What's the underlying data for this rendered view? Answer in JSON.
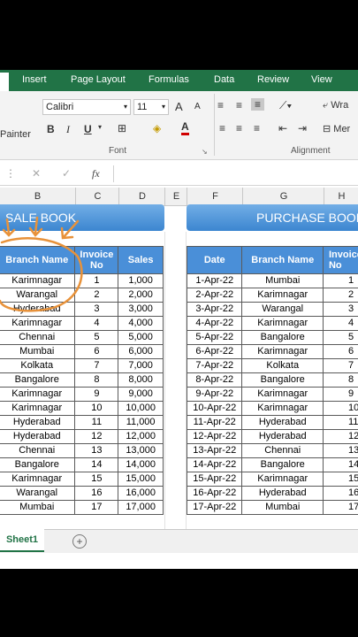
{
  "ribbon_tabs": [
    "Insert",
    "Page Layout",
    "Formulas",
    "Data",
    "Review",
    "View"
  ],
  "ribbon": {
    "font_name": "Calibri",
    "font_size": "11",
    "painter_label": "Painter",
    "font_group_label": "Font",
    "alignment_group_label": "Alignment",
    "wrap_label": "Wra",
    "merge_label": "Mer",
    "bold": "B",
    "italic": "I",
    "underline": "U",
    "grow_font": "A",
    "shrink_font": "A",
    "font_color": "A"
  },
  "formula_bar": {
    "cancel": "✕",
    "enter": "✓",
    "fx": "fx",
    "value": ""
  },
  "columns": [
    "B",
    "C",
    "D",
    "E",
    "F",
    "G",
    "H"
  ],
  "sale_book": {
    "title": "SALE BOOK",
    "headers": [
      "Branch Name",
      "Invoice No",
      "Sales"
    ],
    "rows": [
      [
        "Karimnagar",
        "1",
        "1,000"
      ],
      [
        "Warangal",
        "2",
        "2,000"
      ],
      [
        "Hyderabad",
        "3",
        "3,000"
      ],
      [
        "Karimnagar",
        "4",
        "4,000"
      ],
      [
        "Chennai",
        "5",
        "5,000"
      ],
      [
        "Mumbai",
        "6",
        "6,000"
      ],
      [
        "Kolkata",
        "7",
        "7,000"
      ],
      [
        "Bangalore",
        "8",
        "8,000"
      ],
      [
        "Karimnagar",
        "9",
        "9,000"
      ],
      [
        "Karimnagar",
        "10",
        "10,000"
      ],
      [
        "Hyderabad",
        "11",
        "11,000"
      ],
      [
        "Hyderabad",
        "12",
        "12,000"
      ],
      [
        "Chennai",
        "13",
        "13,000"
      ],
      [
        "Bangalore",
        "14",
        "14,000"
      ],
      [
        "Karimnagar",
        "15",
        "15,000"
      ],
      [
        "Warangal",
        "16",
        "16,000"
      ],
      [
        "Mumbai",
        "17",
        "17,000"
      ]
    ]
  },
  "purchase_book": {
    "title": "PURCHASE BOOK",
    "headers": [
      "Date",
      "Branch Name",
      "Invoice No"
    ],
    "rows": [
      [
        "1-Apr-22",
        "Mumbai",
        "1"
      ],
      [
        "2-Apr-22",
        "Karimnagar",
        "2"
      ],
      [
        "3-Apr-22",
        "Warangal",
        "3"
      ],
      [
        "4-Apr-22",
        "Karimnagar",
        "4"
      ],
      [
        "5-Apr-22",
        "Bangalore",
        "5"
      ],
      [
        "6-Apr-22",
        "Karimnagar",
        "6"
      ],
      [
        "7-Apr-22",
        "Kolkata",
        "7"
      ],
      [
        "8-Apr-22",
        "Bangalore",
        "8"
      ],
      [
        "9-Apr-22",
        "Karimnagar",
        "9"
      ],
      [
        "10-Apr-22",
        "Karimnagar",
        "10"
      ],
      [
        "11-Apr-22",
        "Hyderabad",
        "11"
      ],
      [
        "12-Apr-22",
        "Hyderabad",
        "12"
      ],
      [
        "13-Apr-22",
        "Chennai",
        "13"
      ],
      [
        "14-Apr-22",
        "Bangalore",
        "14"
      ],
      [
        "15-Apr-22",
        "Karimnagar",
        "15"
      ],
      [
        "16-Apr-22",
        "Hyderabad",
        "16"
      ],
      [
        "17-Apr-22",
        "Mumbai",
        "17"
      ]
    ]
  },
  "sheet_tab": "Sheet1",
  "add_sheet": "+",
  "colors": {
    "excel_green": "#217346",
    "header_blue": "#4a8fd8",
    "annotation_orange": "#e8923a"
  }
}
